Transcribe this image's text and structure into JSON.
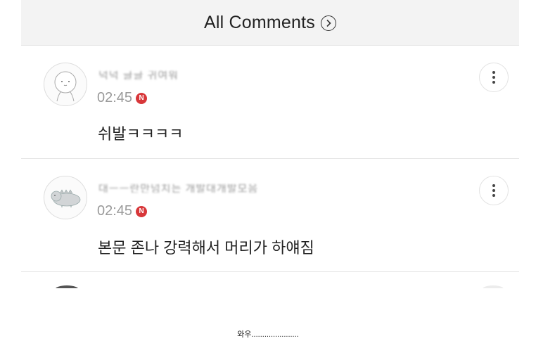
{
  "header": {
    "title": "All Comments",
    "chevron_icon": "chevron-right-circle-icon"
  },
  "comments": [
    {
      "nickname": "넉넉 글글 귀여워",
      "time": "02:45",
      "badge": "N",
      "text": "쉬발ㅋㅋㅋㅋ",
      "avatar_icon": "bear-face-avatar-icon",
      "menu_icon": "more-vertical-icon"
    },
    {
      "nickname": "대ㅡㅡ란만넘치는 개발대개발모음",
      "time": "02:45",
      "badge": "N",
      "text": "본문 존나 강력해서 머리가 하얘짐",
      "avatar_icon": "dinosaur-avatar-icon",
      "menu_icon": "more-vertical-icon"
    }
  ],
  "caption": "와우......................",
  "colors": {
    "badge": "#d8373a",
    "header_bg": "#f3f3f3",
    "time": "#9a9a9a"
  }
}
